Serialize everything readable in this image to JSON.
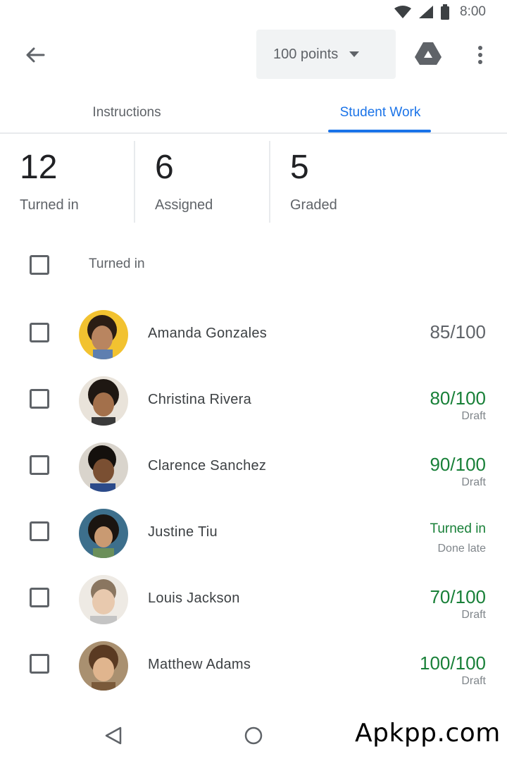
{
  "status_bar": {
    "time": "8:00"
  },
  "app_bar": {
    "points_label": "100 points"
  },
  "tabs": [
    {
      "label": "Instructions",
      "selected": false
    },
    {
      "label": "Student Work",
      "selected": true
    }
  ],
  "stats": [
    {
      "value": "12",
      "label": "Turned in"
    },
    {
      "value": "6",
      "label": "Assigned"
    },
    {
      "value": "5",
      "label": "Graded"
    }
  ],
  "list_header": {
    "label": "Turned in"
  },
  "students": [
    {
      "name": "Amanda Gonzales",
      "grade": "85/100",
      "sub": "",
      "grade_color": "gray"
    },
    {
      "name": "Christina Rivera",
      "grade": "80/100",
      "sub": "Draft",
      "grade_color": "green"
    },
    {
      "name": "Clarence Sanchez",
      "grade": "90/100",
      "sub": "Draft",
      "grade_color": "green"
    },
    {
      "name": "Justine Tiu",
      "grade": "Turned in",
      "sub": "Done late",
      "grade_color": "green"
    },
    {
      "name": "Louis Jackson",
      "grade": "70/100",
      "sub": "Draft",
      "grade_color": "green"
    },
    {
      "name": "Matthew Adams",
      "grade": "100/100",
      "sub": "Draft",
      "grade_color": "green"
    }
  ],
  "watermark": "Apkpp.com",
  "colors": {
    "accent": "#1a73e8",
    "grade_green": "#188038",
    "text_gray": "#5f6368"
  },
  "icons": {
    "back": "arrow-left-icon",
    "dropdown": "caret-down-icon",
    "drive": "google-drive-icon",
    "more": "more-vert-icon",
    "nav_back": "triangle-back-icon",
    "nav_home": "circle-home-icon"
  }
}
